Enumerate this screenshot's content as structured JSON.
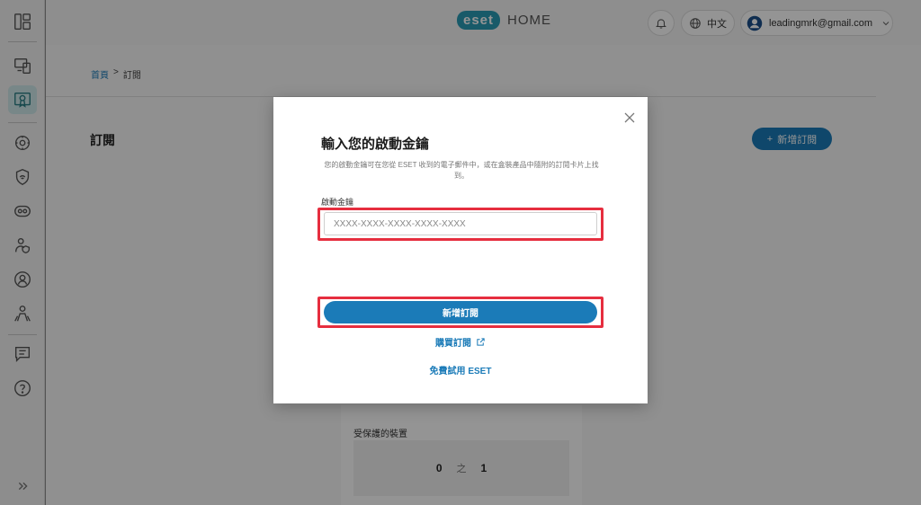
{
  "topbar": {
    "logo_badge": "eset",
    "logo_text": "HOME",
    "language": "中文",
    "account_email": "leadingmrk@gmail.com"
  },
  "breadcrumb": {
    "home": "首頁",
    "separator": ">",
    "current": "訂閱"
  },
  "page": {
    "title": "訂閱",
    "add_button_label": "新增訂閱",
    "card": {
      "protected_devices_label": "受保護的裝置",
      "count_used": "0",
      "count_of": "之",
      "count_total": "1"
    }
  },
  "modal": {
    "title": "輸入您的啟動金鑰",
    "description": "您的啟動金鑰可在您從 ESET 收到的電子郵件中，或在盒裝產品中隨附的訂閱卡片上找到。",
    "field_label": "啟動金鑰",
    "key_placeholder": "XXXX-XXXX-XXXX-XXXX-XXXX",
    "key_value": "",
    "submit_label": "新增訂閱",
    "buy_link": "購買訂閱",
    "trial_link": "免費試用 ESET"
  },
  "colors": {
    "accent": "#1b7bb8",
    "highlight": "#e62e3f",
    "brand": "#2a9bb6"
  },
  "icons": {
    "sidebar": [
      "dashboard-icon",
      "devices-icon",
      "subscriptions-icon",
      "security-icon",
      "shield-icon",
      "vpn-icon",
      "parental-icon",
      "identity-icon",
      "family-icon",
      "feedback-icon",
      "help-icon",
      "expand-icon"
    ],
    "topbar": [
      "bell-icon",
      "globe-icon",
      "avatar",
      "chevron-down-icon"
    ]
  }
}
